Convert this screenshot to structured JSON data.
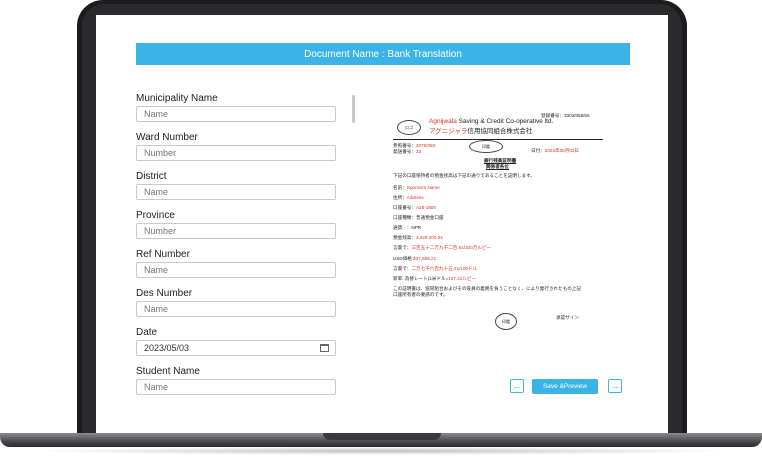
{
  "header": {
    "title": "Document Name : Bank Translation"
  },
  "form": {
    "fields": [
      {
        "label": "Municipality Name",
        "placeholder": "Name"
      },
      {
        "label": "Ward Number",
        "placeholder": "Number"
      },
      {
        "label": "District",
        "placeholder": "Name"
      },
      {
        "label": "Province",
        "placeholder": "Number"
      },
      {
        "label": "Ref Number",
        "placeholder": "Name"
      },
      {
        "label": "Des Number",
        "placeholder": "Name"
      },
      {
        "label": "Date",
        "value": "2023/05/03"
      },
      {
        "label": "Student Name",
        "placeholder": "Name"
      }
    ]
  },
  "preview": {
    "reg_no": "登録番号：3303/065/66",
    "org_en": "Agnijwala Saving & Credit Co-operative ltd.",
    "org_en_highlight": "Agnijwala",
    "org_jp_highlight": "アグニジャラ",
    "org_jp_rest": "信用協同組合株式会社",
    "logo_label": "ロゴ",
    "ref_label": "参照番号：",
    "ref_value": "2079/080",
    "dispatch_label": "発送番号：",
    "dispatch_value": "23",
    "photo_label": "印鑑",
    "date_label": "日付：",
    "date_value": "2023年05月03日",
    "title1": "銀行残高証明書",
    "title2": "関係者各位",
    "intro": "下記の口座保持者の預金残高は下記の通りであることを証明します。",
    "name_label": "名前：",
    "name_value": "Sponsors Name",
    "address_label": "住所：",
    "address_value": "Address",
    "account_label": "口座番号：",
    "account_value": "A28-1808",
    "account_type": "口座種類：普通預金口座",
    "currency_label": "通貨　：",
    "currency_value": "NPR",
    "balance_label": "預金残高：",
    "balance_value": "3,329,200.54",
    "words_label": "言葉で：",
    "words_value": "三百五十二万九千二百.54/100万ルピー",
    "usd_label": "USD価格:",
    "usd_value": "$27,695.21",
    "words_usd_label": "言葉で：",
    "words_usd_value": "二万七千六百九十五.21/100ドル",
    "rate_label": "新率: 為替レート(1米ドル=",
    "rate_value": "127.41",
    "rate_suffix": "ルピー",
    "closing": "この証明書は、協同組合およびその役員の義務を負うことなく、により発行されたもの上記口座所有者の要請のです。",
    "stamp_label": "印鑑",
    "signature_label": "承認サイン"
  },
  "actions": {
    "prev_icon": "←",
    "save_label": "Save &Preview",
    "next_icon": "→"
  }
}
